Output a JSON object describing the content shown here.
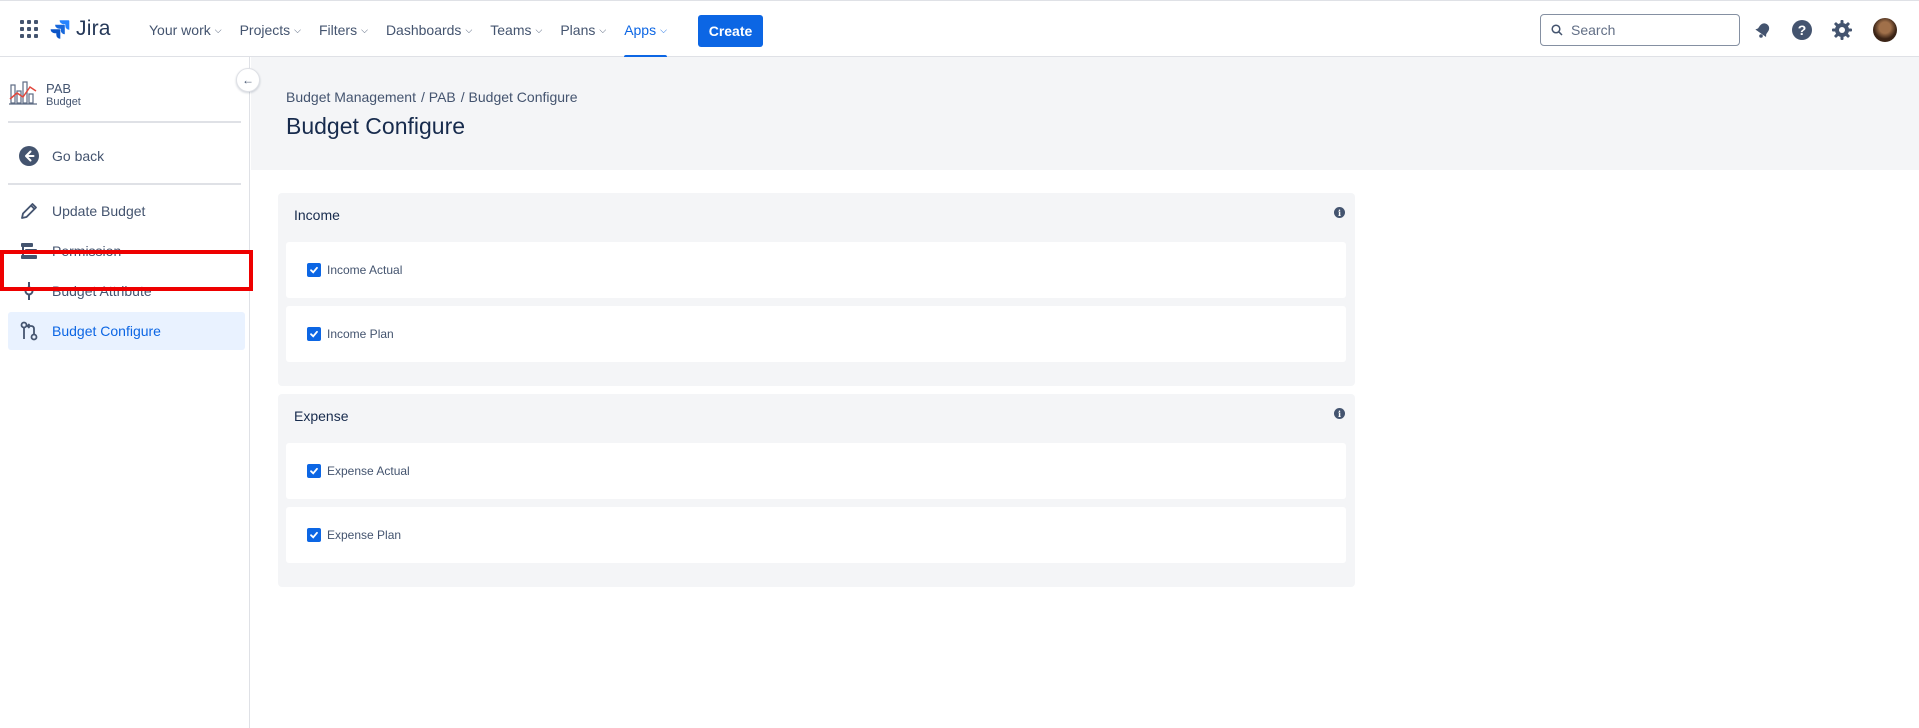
{
  "app": {
    "name": "Jira"
  },
  "nav": {
    "items": [
      {
        "label": "Your work"
      },
      {
        "label": "Projects"
      },
      {
        "label": "Filters"
      },
      {
        "label": "Dashboards"
      },
      {
        "label": "Teams"
      },
      {
        "label": "Plans"
      },
      {
        "label": "Apps",
        "active": true
      }
    ],
    "create_label": "Create"
  },
  "search": {
    "placeholder": "Search"
  },
  "top_icons": [
    "notifications-icon",
    "help-icon",
    "settings-icon",
    "avatar"
  ],
  "sidebar": {
    "project": {
      "name": "PAB",
      "type": "Budget"
    },
    "go_back": "Go back",
    "items": [
      {
        "label": "Update Budget",
        "icon": "pencil-icon"
      },
      {
        "label": "Permission",
        "icon": "permission-icon"
      },
      {
        "label": "Budget Attribute",
        "icon": "attribute-icon"
      },
      {
        "label": "Budget Configure",
        "icon": "configure-icon",
        "selected": true
      }
    ]
  },
  "breadcrumbs": [
    "Budget Management",
    "/ PAB",
    "/ Budget Configure"
  ],
  "page": {
    "title": "Budget Configure"
  },
  "sections": [
    {
      "title": "Income",
      "rows": [
        {
          "label": "Income Actual",
          "checked": true
        },
        {
          "label": "Income Plan",
          "checked": true
        }
      ]
    },
    {
      "title": "Expense",
      "rows": [
        {
          "label": "Expense Actual",
          "checked": true
        },
        {
          "label": "Expense Plan",
          "checked": true
        }
      ]
    }
  ],
  "colors": {
    "accent": "#0c66e4",
    "highlight_box": "#ee0000",
    "header_band": "#f4f5f7"
  }
}
